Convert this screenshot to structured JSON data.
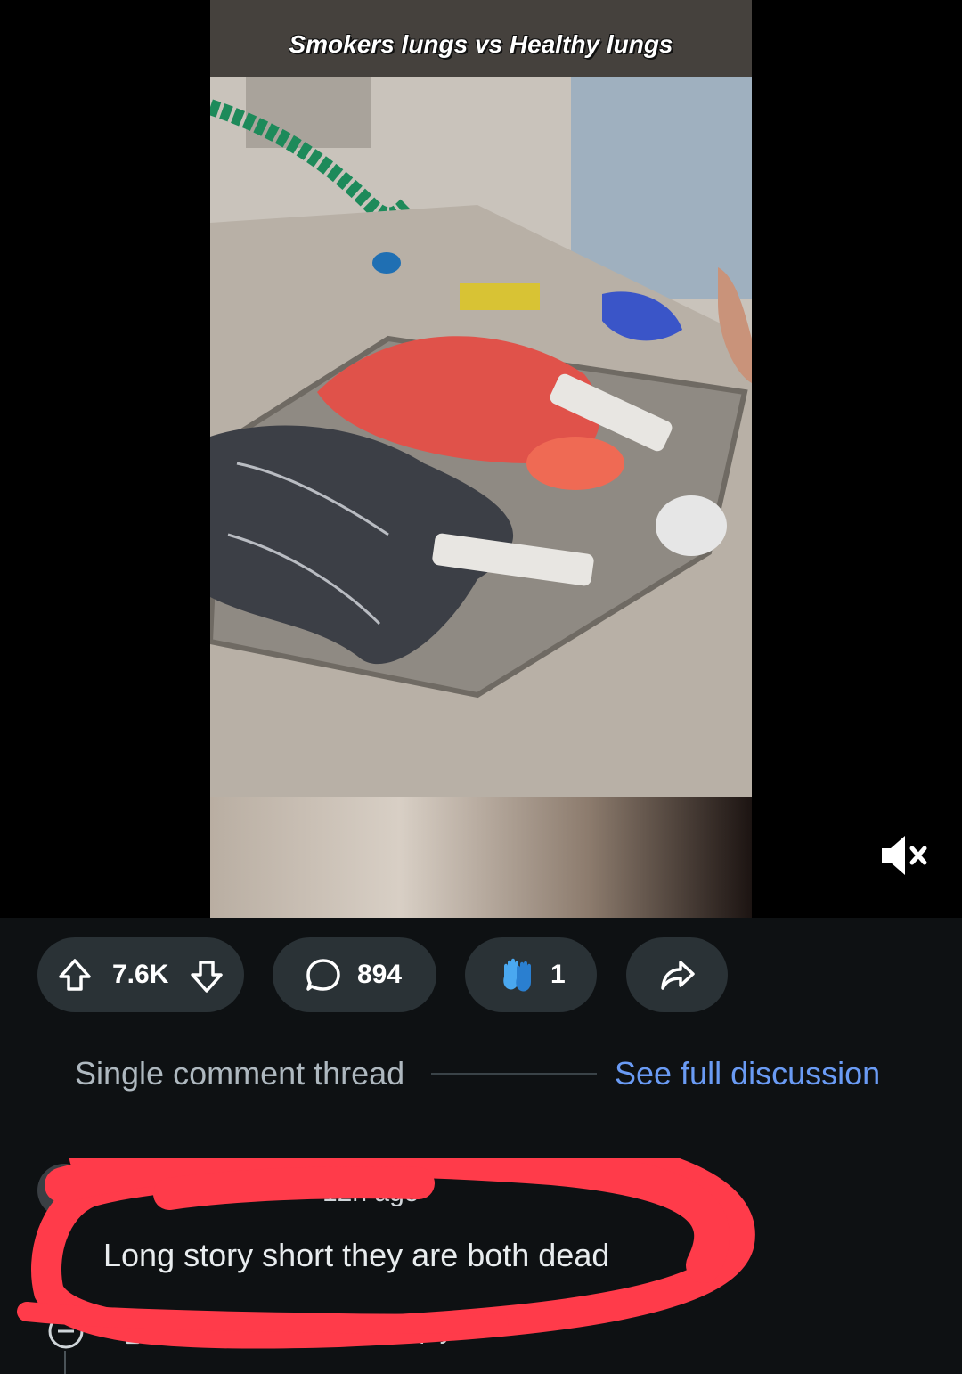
{
  "video": {
    "caption": "Smokers lungs vs Healthy lungs",
    "mute_icon": "speaker-muted-icon"
  },
  "actions": {
    "upvote_icon": "arrow-up-icon",
    "votes": "7.6K",
    "downvote_icon": "arrow-down-icon",
    "comment_icon": "speech-bubble-icon",
    "comments": "894",
    "award_icon": "waving-hands-icon",
    "awards": "1",
    "share_icon": "share-arrow-icon"
  },
  "thread": {
    "label": "Single comment thread",
    "see_full": "See full discussion"
  },
  "comment": {
    "age": "12h ago",
    "text": "Long story short they are both dead",
    "votes": "1.2K",
    "reply_label": "Reply",
    "collapse_icon": "minus-circle-icon"
  },
  "colors": {
    "background": "#0e1113",
    "pill": "#2a3236",
    "link": "#6a9bf4",
    "highlight": "#ff3b4a"
  }
}
